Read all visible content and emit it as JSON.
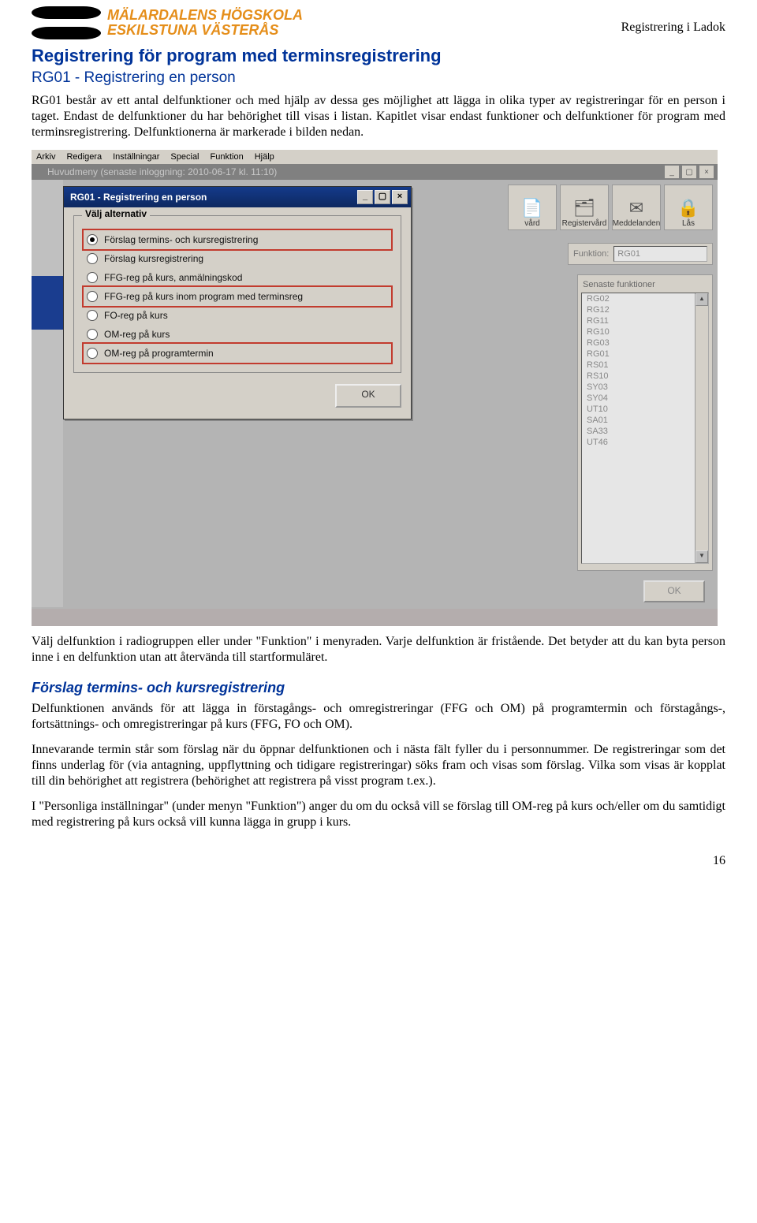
{
  "header": {
    "logo_line1": "MÄLARDALENS HÖGSKOLA",
    "logo_line2": "ESKILSTUNA VÄSTERÅS",
    "doc_title": "Registrering i Ladok"
  },
  "h1": "Registrering för program med terminsregistrering",
  "h2": "RG01 - Registrering en person",
  "para1": "RG01 består av ett antal delfunktioner och med hjälp av dessa ges möjlighet att lägga in olika typer av registreringar för en person i taget. Endast de delfunktioner du har behörighet till visas i listan. Kapitlet visar endast funktioner och delfunktioner för program med terminsregistrering. Delfunktionerna är markerade i bilden nedan.",
  "screenshot": {
    "menu": [
      "Arkiv",
      "Redigera",
      "Inställningar",
      "Special",
      "Funktion",
      "Hjälp"
    ],
    "main_title": "Huvudmeny   (senaste inloggning: 2010-06-17 kl. 11:10)",
    "toolbar": [
      {
        "label": "vård",
        "icon": "📄"
      },
      {
        "label": "Registervård",
        "icon": "🗂"
      },
      {
        "label": "Meddelanden",
        "icon": "✉"
      },
      {
        "label": "Lås",
        "icon": "🔒"
      }
    ],
    "funktion_label": "Funktion:",
    "funktion_value": "RG01",
    "recent_header": "Senaste funktioner",
    "recent": [
      "RG02",
      "RG12",
      "RG11",
      "RG10",
      "RG03",
      "RG01",
      "RS01",
      "RS10",
      "SY03",
      "SY04",
      "UT10",
      "SA01",
      "SA33",
      "UT46"
    ],
    "dialog_title": "RG01 - Registrering en person",
    "group_legend": "Välj alternativ",
    "radios": [
      {
        "label": "Förslag termins- och kursregistrering",
        "checked": true,
        "highlight": true
      },
      {
        "label": "Förslag kursregistrering",
        "checked": false,
        "highlight": false
      },
      {
        "label": "FFG-reg på kurs, anmälningskod",
        "checked": false,
        "highlight": false
      },
      {
        "label": "FFG-reg på kurs inom program med terminsreg",
        "checked": false,
        "highlight": true
      },
      {
        "label": "FO-reg på kurs",
        "checked": false,
        "highlight": false
      },
      {
        "label": "OM-reg på kurs",
        "checked": false,
        "highlight": false
      },
      {
        "label": "OM-reg på programtermin",
        "checked": false,
        "highlight": true
      }
    ],
    "ok_label": "OK",
    "status_line": ""
  },
  "para2": "Välj delfunktion i radiogruppen eller under \"Funktion\" i menyraden. Varje delfunktion är fristående. Det betyder att du kan byta person inne i en delfunktion utan att återvända till startformuläret.",
  "h3": "Förslag termins- och kursregistrering",
  "para3": "Delfunktionen används för att lägga in förstagångs- och omregistreringar (FFG och OM) på programtermin och förstagångs-, fortsättnings- och omregistreringar på kurs (FFG, FO och OM).",
  "para4": "Innevarande termin står som förslag när du öppnar delfunktionen och i nästa fält fyller du i personnummer. De registreringar som det finns underlag för (via antagning, uppflyttning och tidigare registreringar) söks fram och visas som förslag. Vilka som visas är kopplat till din behörighet att registrera (behörighet att registrera på visst program t.ex.).",
  "para5": "I \"Personliga inställningar\" (under menyn \"Funktion\") anger du om du också vill se förslag till OM-reg på kurs och/eller om du samtidigt med registrering på kurs också vill kunna lägga in grupp i kurs.",
  "page_number": "16"
}
